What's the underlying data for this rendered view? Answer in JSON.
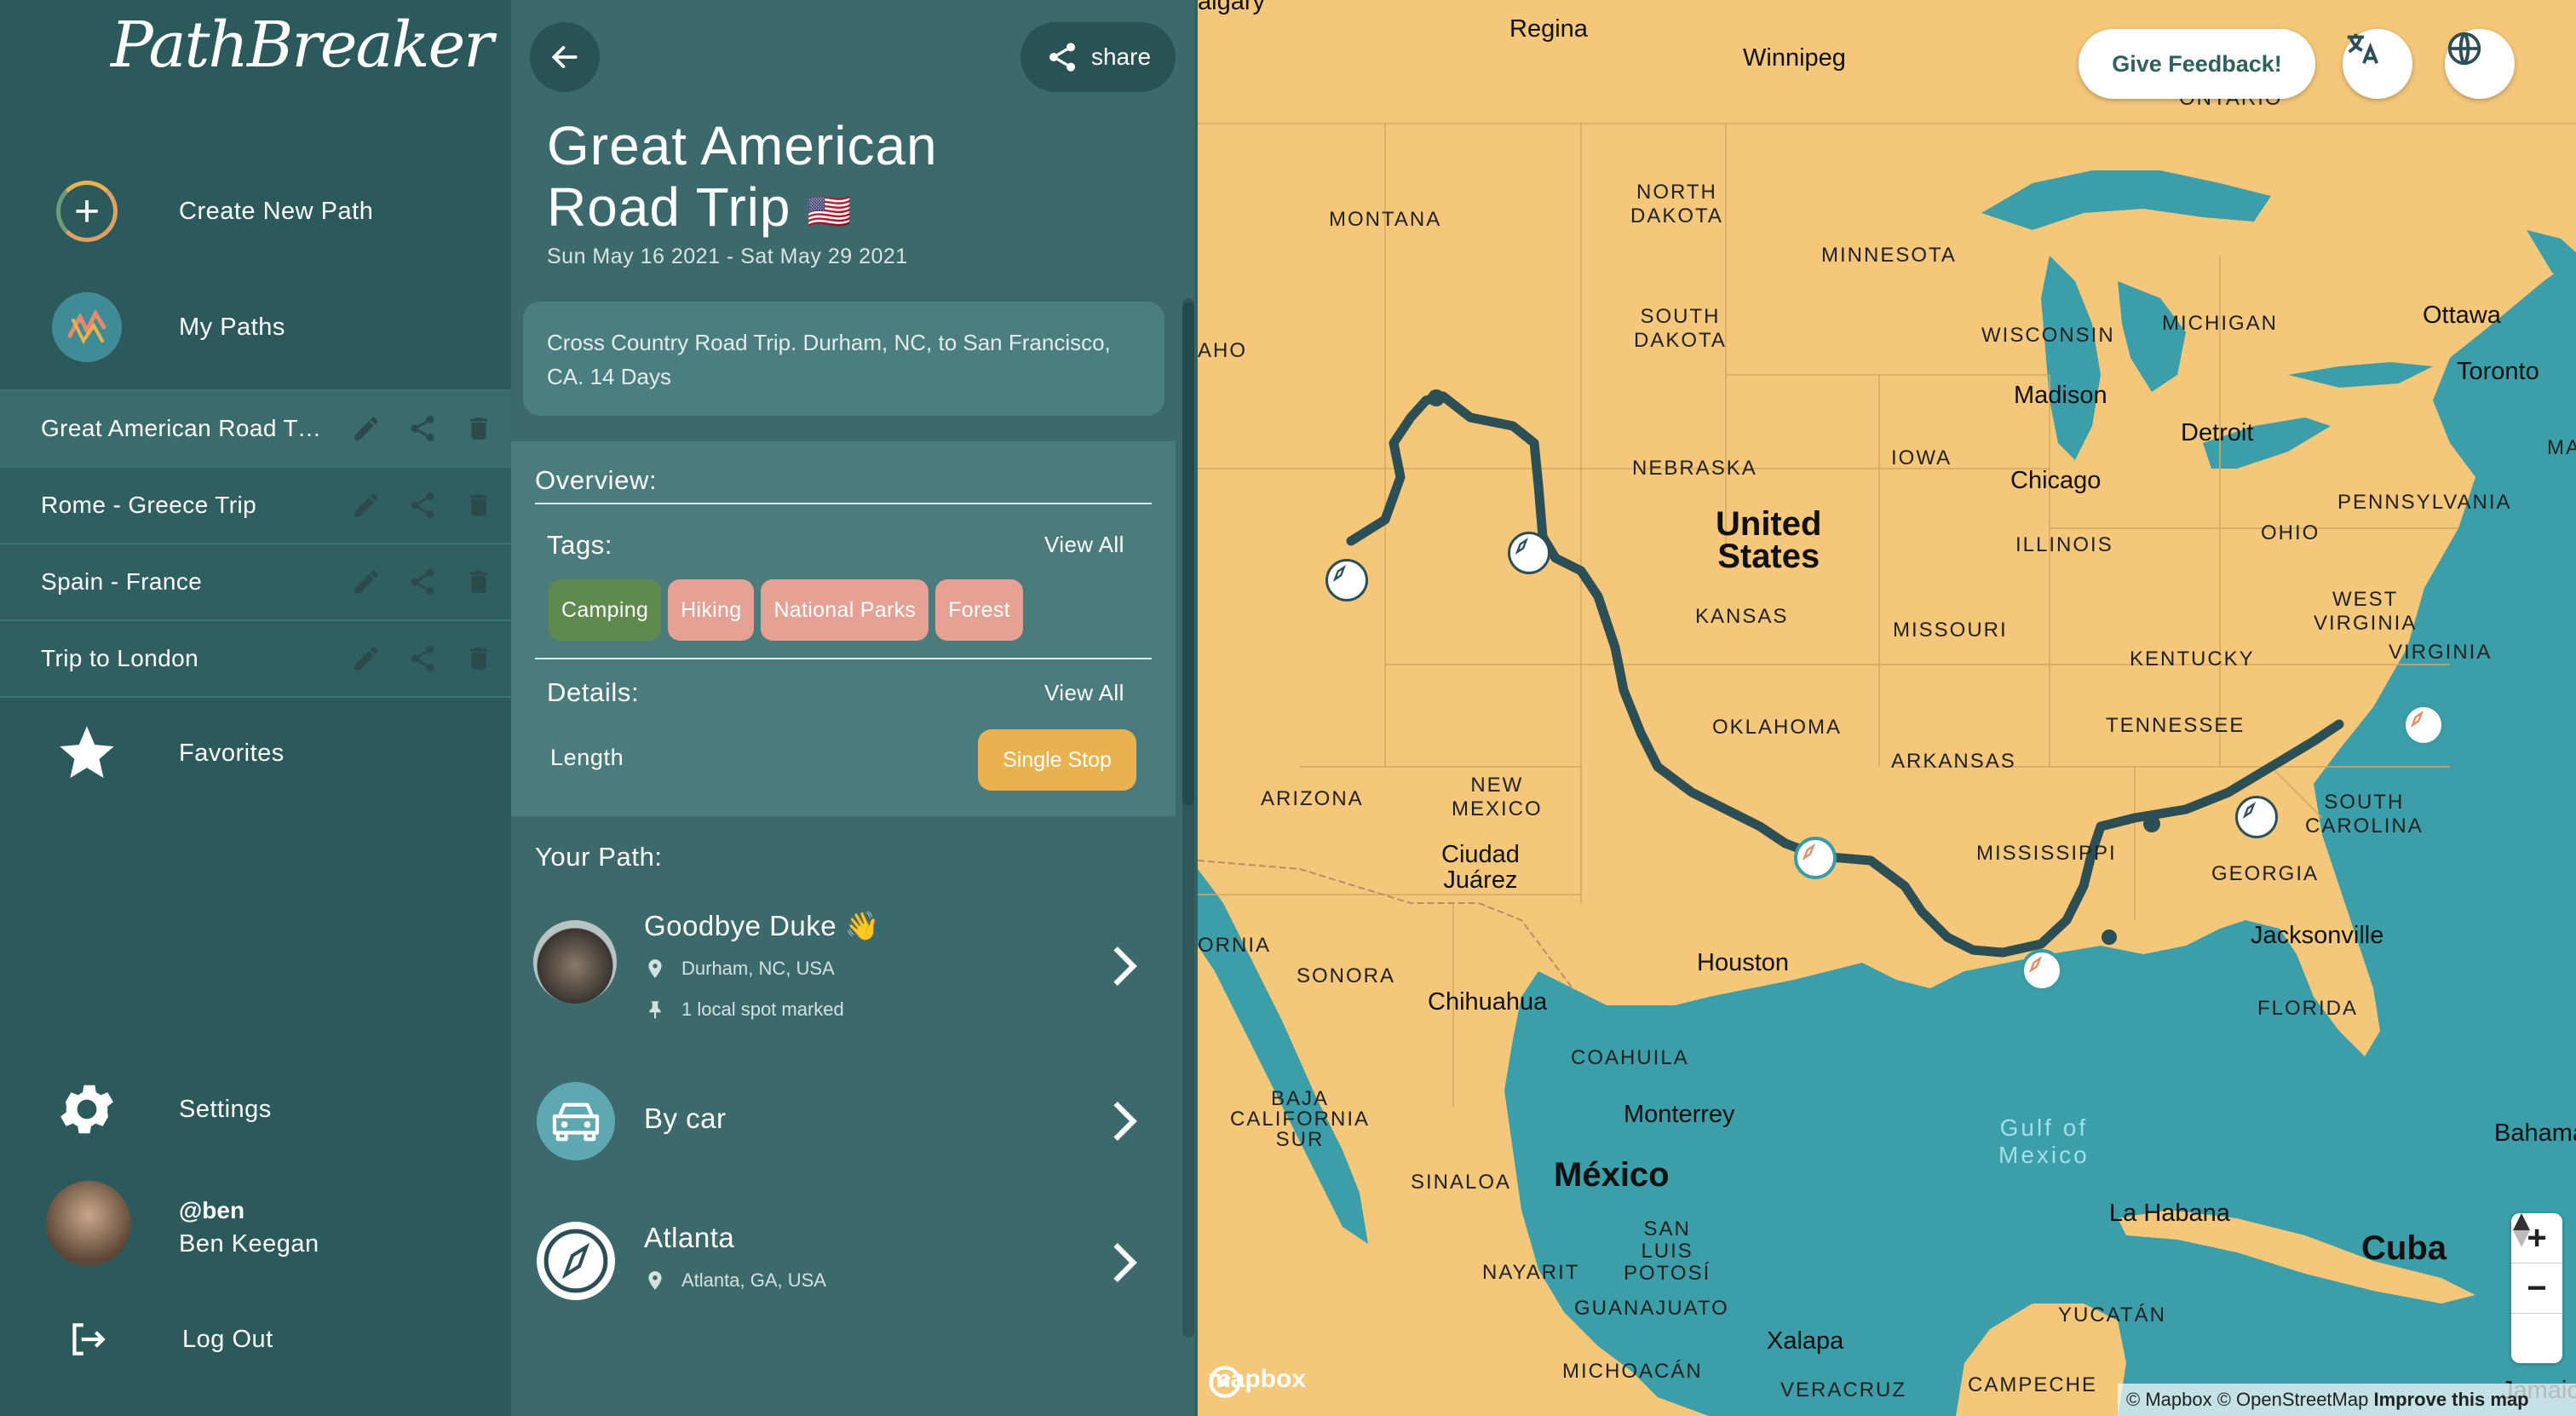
{
  "app": {
    "logo_text": "PathBreaker"
  },
  "sidebar": {
    "create_label": "Create New Path",
    "mypaths_label": "My Paths",
    "trips": [
      {
        "name": "Great American Road Trip",
        "active": true
      },
      {
        "name": "Rome - Greece Trip",
        "active": false
      },
      {
        "name": "Spain - France",
        "active": false
      },
      {
        "name": "Trip to London",
        "active": false
      }
    ],
    "favorites_label": "Favorites",
    "settings_label": "Settings",
    "profile": {
      "handle": "@ben",
      "name": "Ben Keegan"
    },
    "logout_label": "Log Out"
  },
  "panel": {
    "share_label": "share",
    "title": "Great American Road Trip",
    "title_flag": "🇺🇸",
    "dates": "Sun May 16 2021 - Sat May 29 2021",
    "description": "Cross Country Road Trip. Durham, NC, to San Francisco, CA. 14 Days",
    "overview_label": "Overview:",
    "tags_label": "Tags:",
    "tags_viewall": "View All",
    "tags": [
      {
        "label": "Camping",
        "color": "#5e8a4e"
      },
      {
        "label": "Hiking",
        "color": "#e5a194"
      },
      {
        "label": "National Parks",
        "color": "#e5a194"
      },
      {
        "label": "Forest",
        "color": "#e5a194"
      }
    ],
    "details_label": "Details:",
    "details_viewall": "View All",
    "length_label": "Length",
    "length_value": "Single Stop",
    "your_path_label": "Your Path:",
    "path_items": [
      {
        "title": "Goodbye Duke 👋",
        "location": "Durham, NC, USA",
        "note": "1 local spot marked"
      },
      {
        "title": "By car"
      },
      {
        "title": "Atlanta",
        "location": "Atlanta, GA, USA"
      }
    ]
  },
  "map": {
    "feedback_label": "Give Feedback!",
    "zoom_in": "+",
    "zoom_out": "−",
    "brand": "mapbox",
    "attribution": "© Mapbox © OpenStreetMap",
    "improve": "Improve this map",
    "colors": {
      "land": "#f4c77a",
      "water": "#3b9ea8",
      "route": "#2b4f55"
    },
    "labels": {
      "regina": "Regina",
      "winnipeg": "Winnipeg",
      "calgary": "algary",
      "ontario": "ONTARIO",
      "montana": "MONTANA",
      "north_dakota": "NORTH\nDAKOTA",
      "minnesota": "MINNESOTA",
      "south_dakota": "SOUTH\nDAKOTA",
      "wisconsin": "WISCONSIN",
      "michigan": "MICHIGAN",
      "idaho": "AHO",
      "nebraska": "NEBRASKA",
      "iowa": "IOWA",
      "illinois": "ILLINOIS",
      "ohio": "OHIO",
      "pennsylvania": "PENNSYLVANIA",
      "west_virginia": "WEST\nVIRGINIA",
      "virginia": "VIRGINIA",
      "kansas": "KANSAS",
      "missouri": "MISSOURI",
      "kentucky": "KENTUCKY",
      "tennessee": "TENNESSEE",
      "oklahoma": "OKLAHOMA",
      "arkansas": "ARKANSAS",
      "arizona": "ARIZONA",
      "new_mexico": "NEW\nMEXICO",
      "mississippi": "MISSISSIPPI",
      "south_carolina": "SOUTH\nCAROLINA",
      "georgia": "GEORGIA",
      "florida": "FLORIDA",
      "sonora": "SONORA",
      "coahuila": "COAHUILA",
      "baja": "BAJA\nCALIFORNIA\nSUR",
      "sinaloa": "SINALOA",
      "nayarit": "NAYARIT",
      "san_luis": "SAN\nLUIS\nPOTOSÍ",
      "guanajuato": "GUANAJUATO",
      "michoacan": "MICHOACÁN",
      "veracruz": "VERACRUZ",
      "campeche": "CAMPECHE",
      "yucatan": "YUCATÁN",
      "ornia": "ORNIA",
      "madison": "Madison",
      "detroit": "Detroit",
      "chicago": "Chicago",
      "ottawa": "Ottawa",
      "toronto": "Toronto",
      "ma": "MA",
      "ciudad_juarez": "Ciudad\nJuárez",
      "houston": "Houston",
      "chihuahua": "Chihuahua",
      "monterrey": "Monterrey",
      "jacksonville": "Jacksonville",
      "bahamas": "Bahamas",
      "la_habana": "La Habana",
      "xalapa": "Xalapa",
      "jamaica": "Jamaica",
      "united_states": "United\nStates",
      "mexico": "México",
      "cuba": "Cuba",
      "gulf": "Gulf of\nMexico"
    }
  }
}
